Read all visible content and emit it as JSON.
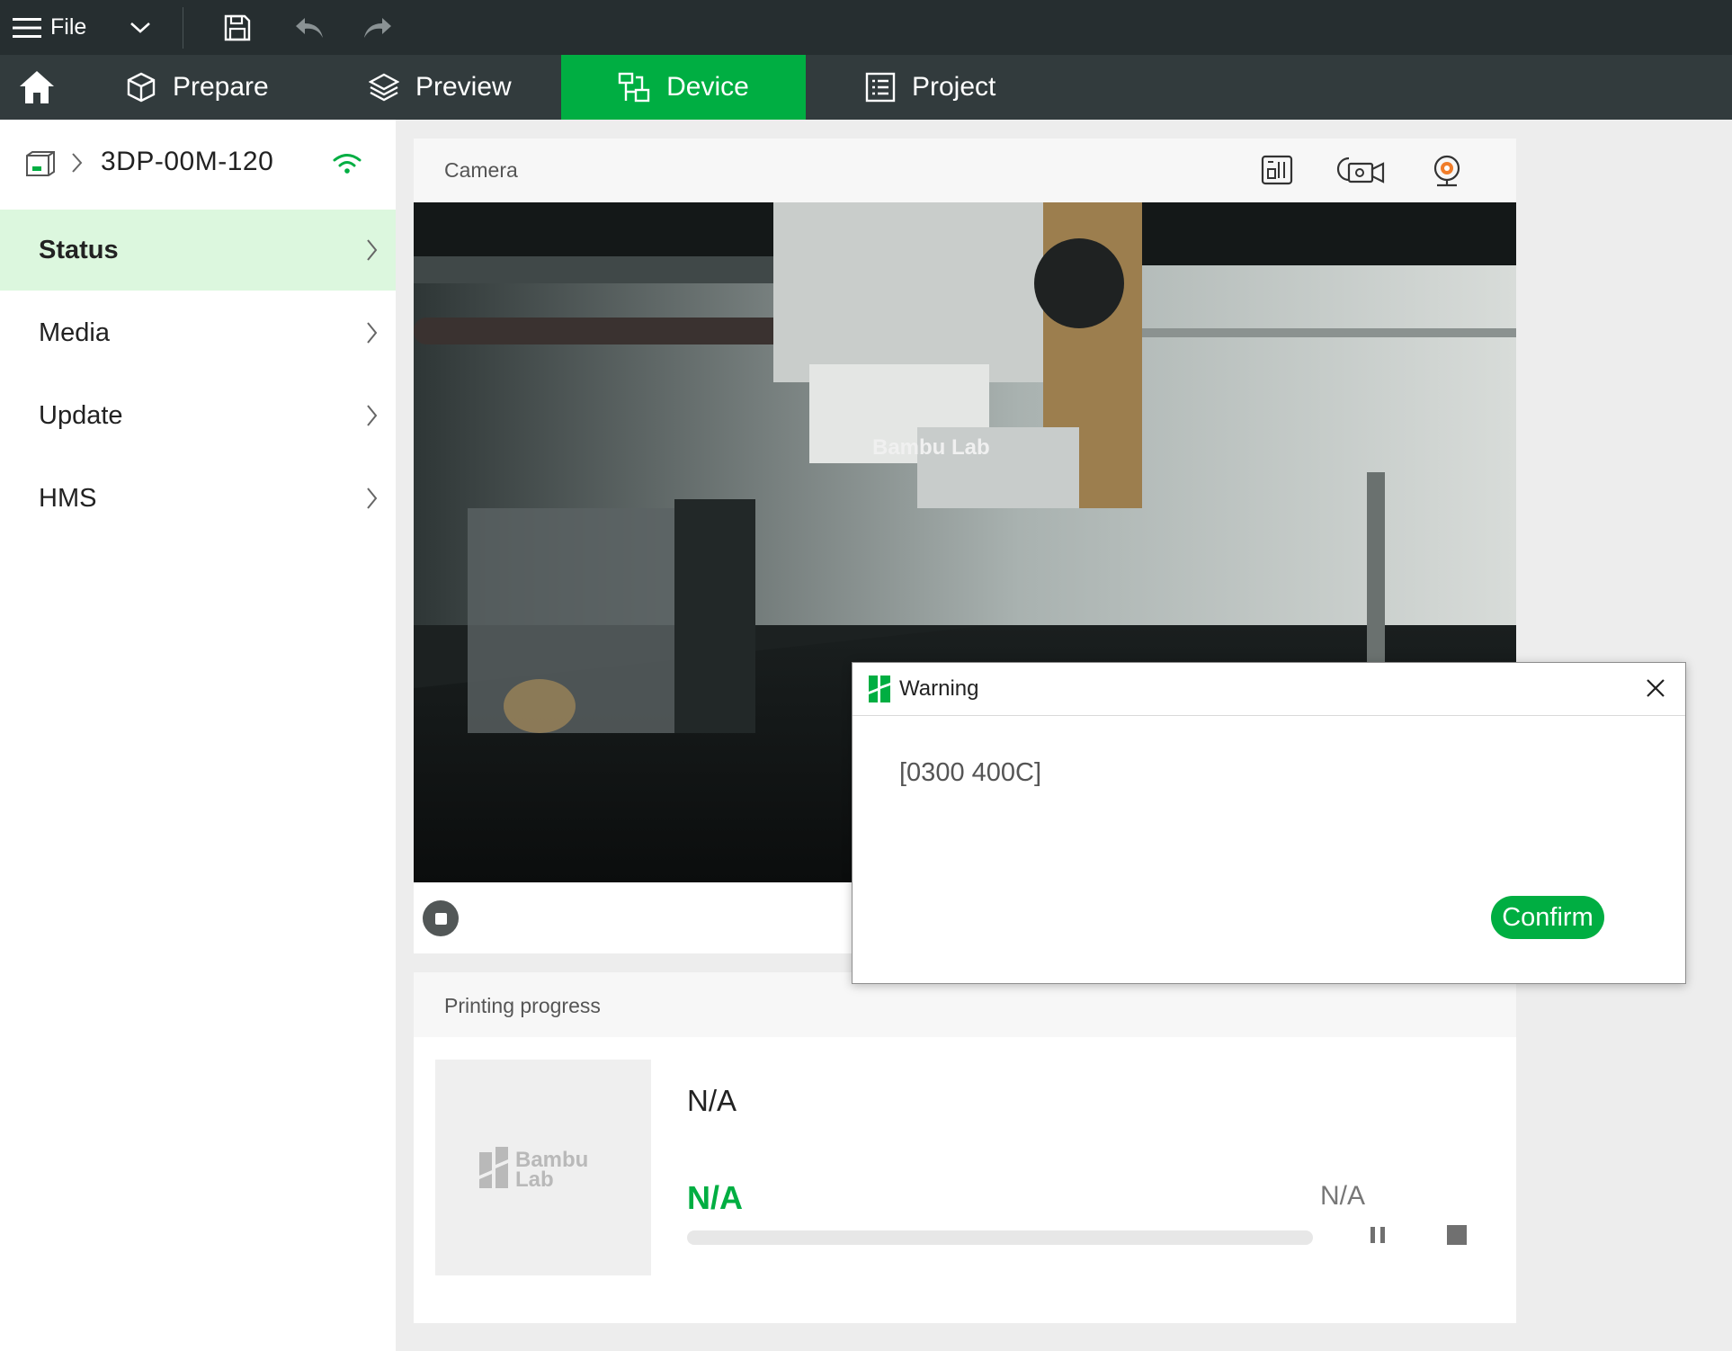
{
  "menubar": {
    "file_label": "File",
    "icons": [
      "menu-icon",
      "chevron-down-icon",
      "save-icon",
      "undo-icon",
      "redo-icon"
    ]
  },
  "tabs": {
    "home_icon": "home-icon",
    "items": [
      {
        "label": "Prepare",
        "icon": "cube-icon"
      },
      {
        "label": "Preview",
        "icon": "layers-icon"
      },
      {
        "label": "Device",
        "icon": "device-icon",
        "active": true
      },
      {
        "label": "Project",
        "icon": "list-icon"
      }
    ]
  },
  "sidebar": {
    "device_name": "3DP-00M-120",
    "connection_icon": "wifi-icon",
    "items": [
      {
        "label": "Status",
        "active": true
      },
      {
        "label": "Media"
      },
      {
        "label": "Update"
      },
      {
        "label": "HMS"
      }
    ]
  },
  "camera": {
    "title": "Camera",
    "icons": [
      "sd-card-icon",
      "record-video-icon",
      "webcam-icon"
    ],
    "overlay_text": "Bambu Lab"
  },
  "progress": {
    "title": "Printing progress",
    "thumbnail_logo": [
      "Bambu",
      "Lab"
    ],
    "job_name": "N/A",
    "percent": "N/A",
    "time_remaining": "N/A",
    "progress_value": 0
  },
  "dialog": {
    "title": "Warning",
    "message": "[0300 400C]",
    "confirm_label": "Confirm"
  },
  "colors": {
    "accent": "#00ae42",
    "menubar_bg": "#262e30",
    "tabbar_bg": "#323b3d",
    "active_nav_bg": "#dcf7de"
  }
}
